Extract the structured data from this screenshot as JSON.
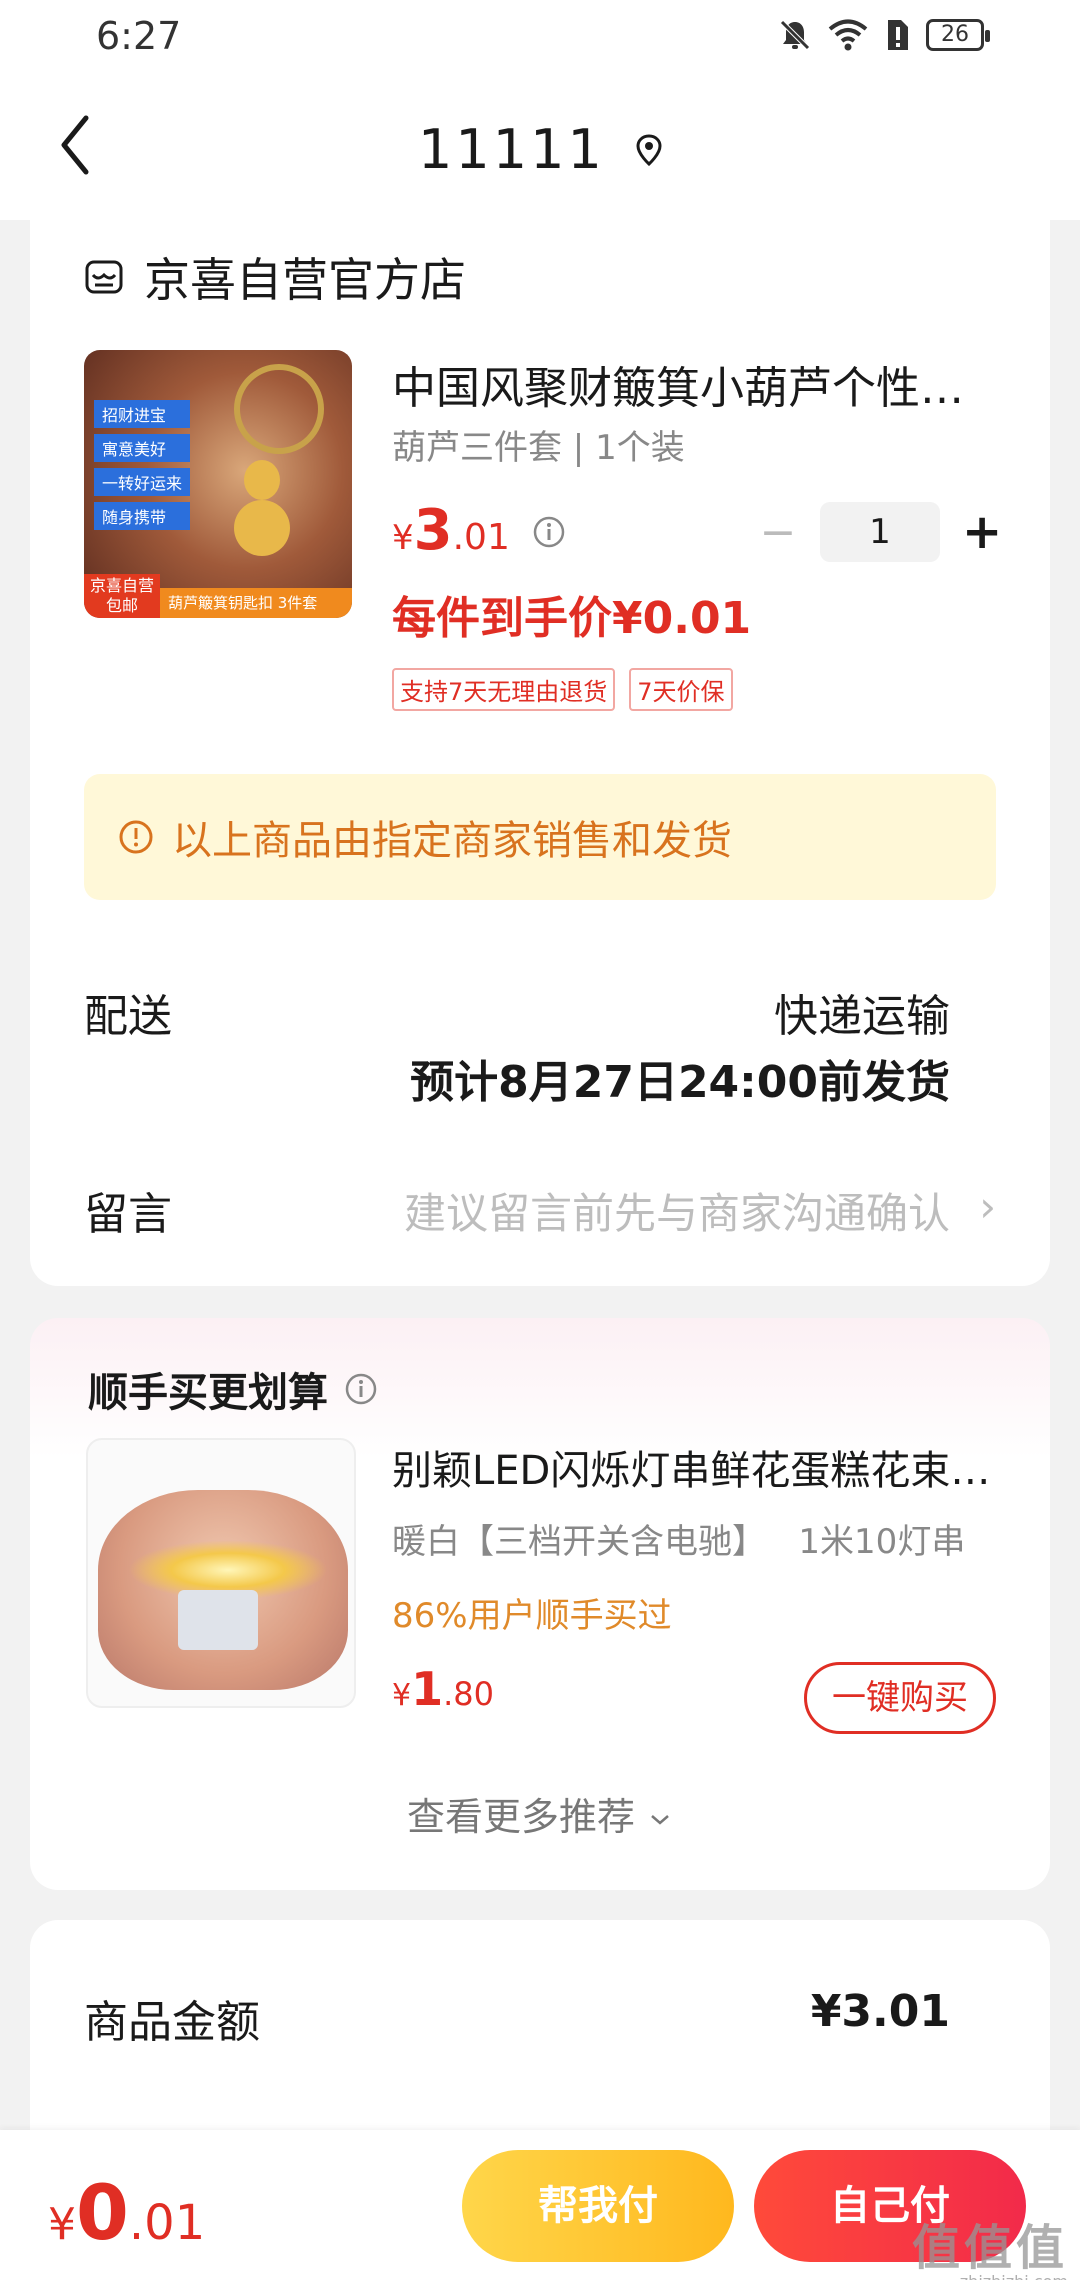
{
  "status_bar": {
    "time": "6:27",
    "battery": "26"
  },
  "header": {
    "title": "11111"
  },
  "shop": {
    "name": "京喜自营官方店"
  },
  "product": {
    "image_tags": [
      "招财进宝",
      "寓意美好",
      "一转好运来",
      "随身携带"
    ],
    "image_badge_top": "京喜自营",
    "image_badge_bottom": "包邮",
    "image_strip": "葫芦簸箕钥匙扣 3件套",
    "title": "中国风聚财簸箕小葫芦个性创意钥匙扣挂件",
    "spec": "葫芦三件套 | 1个装",
    "price_yen": "¥",
    "price_int": "3",
    "price_dec": ".01",
    "quantity": "1",
    "unit_price": "每件到手价¥0.01",
    "service_tags": [
      "支持7天无理由退货",
      "7天价保"
    ]
  },
  "notice": {
    "text": "以上商品由指定商家销售和发货"
  },
  "delivery": {
    "label": "配送",
    "mode": "快递运输",
    "eta": "预计8月27日24:00前发货"
  },
  "message": {
    "label": "留言",
    "placeholder": "建议留言前先与商家沟通确认"
  },
  "recommend": {
    "title": "顺手买更划算",
    "item": {
      "name": "别颖LED闪烁灯串鲜花蛋糕花束装饰灯",
      "spec": "暖白【三档开关含电驰】   1米10灯串",
      "bought": "86%用户顺手买过",
      "price_yen": "¥",
      "price_int": "1",
      "price_dec": ".80",
      "buy_label": "一键购买"
    },
    "more_label": "查看更多推荐"
  },
  "summary": {
    "amount_label": "商品金额",
    "amount_value": "¥3.01"
  },
  "bottom_bar": {
    "total_yen": "¥",
    "total_int": "0",
    "total_dec": ".01",
    "help_pay_label": "帮我付",
    "self_pay_label": "自己付",
    "watermark_main": "值值值",
    "watermark_sub": "zhizhizhi.com"
  },
  "colors": {
    "accent_red": "#e02e24",
    "notice_bg": "#fff8d8",
    "notice_text": "#d8731e",
    "help_btn": "#ffc42a",
    "pay_btn": "#f5343f"
  }
}
